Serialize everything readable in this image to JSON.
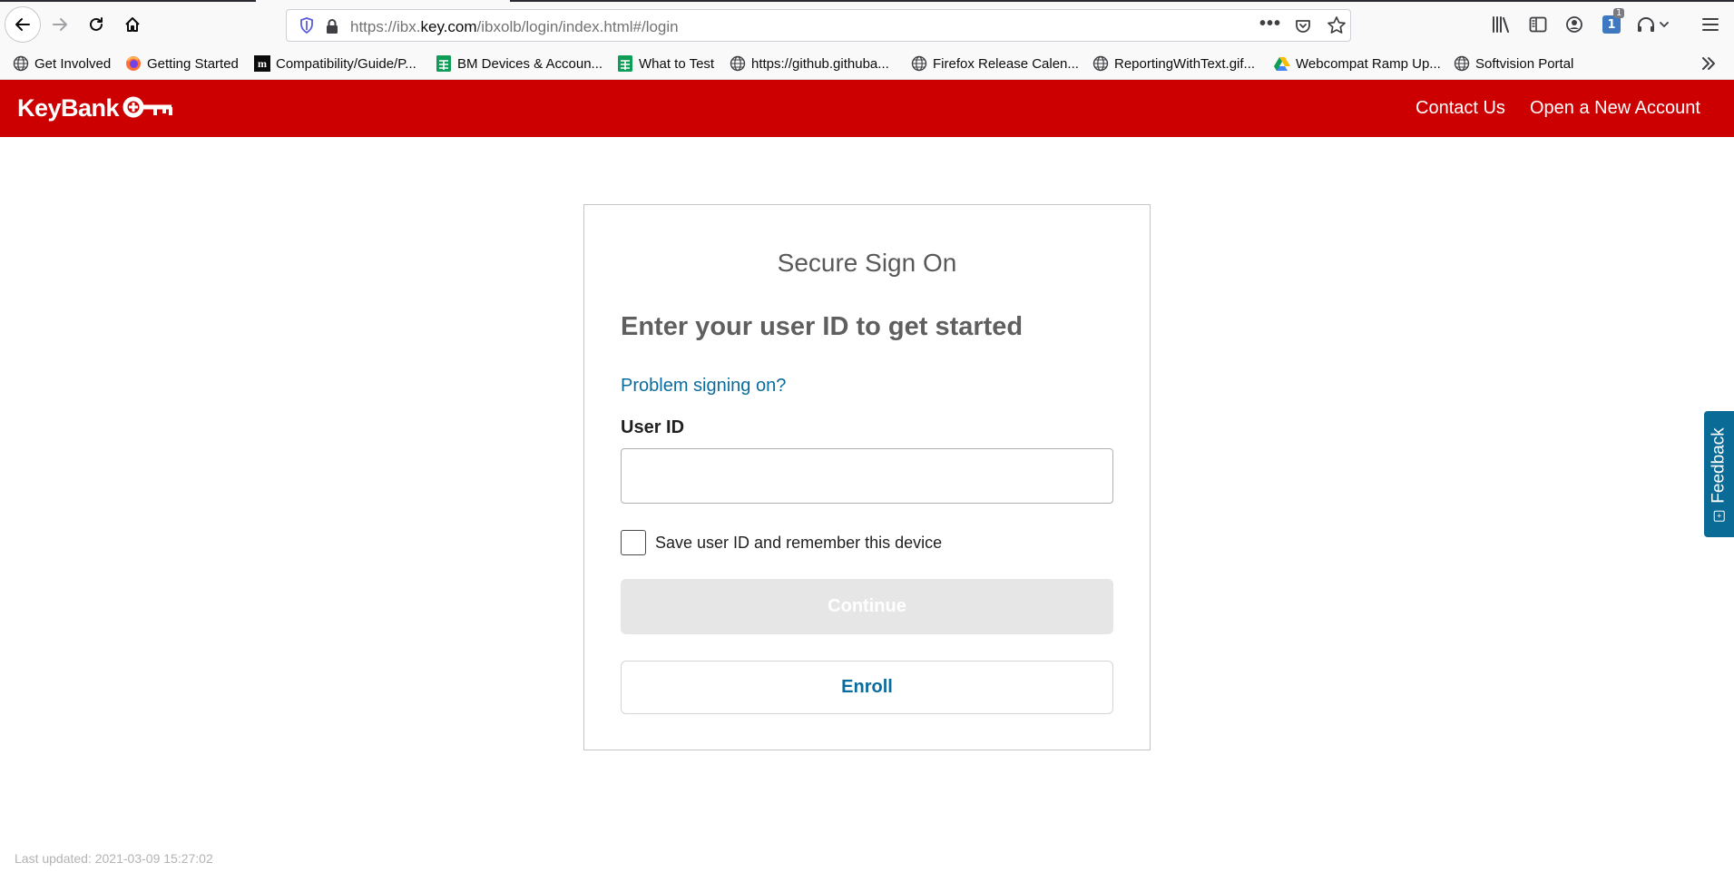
{
  "browser": {
    "url_prefix": "https://ibx.",
    "url_domain": "key.com",
    "url_path": "/ibxolb/login/index.html#/login",
    "page_actions_icon": "•••",
    "extension_badge": "1",
    "extension_label": "1"
  },
  "bookmarks": [
    {
      "label": "Get Involved",
      "icon": "globe-icon"
    },
    {
      "label": "Getting Started",
      "icon": "firefox-icon"
    },
    {
      "label": "Compatibility/Guide/P...",
      "icon": "m-logo-icon"
    },
    {
      "label": "BM Devices & Accoun...",
      "icon": "sheets-icon"
    },
    {
      "label": "What to Test",
      "icon": "sheets-icon"
    },
    {
      "label": "https://github.githuba...",
      "icon": "globe-icon"
    },
    {
      "label": "Firefox Release Calen...",
      "icon": "globe-icon"
    },
    {
      "label": "ReportingWithText.gif...",
      "icon": "globe-icon"
    },
    {
      "label": "Webcompat Ramp Up...",
      "icon": "drive-icon"
    },
    {
      "label": "Softvision Portal",
      "icon": "globe-icon"
    }
  ],
  "header": {
    "logo_text": "KeyBank",
    "contact_label": "Contact Us",
    "open_account_label": "Open a New Account",
    "brand_color": "#cc0000"
  },
  "signon": {
    "title": "Secure Sign On",
    "heading": "Enter your user ID to get started",
    "problem_link": "Problem signing on?",
    "userid_label": "User ID",
    "userid_value": "",
    "remember_label": "Save user ID and remember this device",
    "remember_checked": false,
    "continue_label": "Continue",
    "enroll_label": "Enroll",
    "link_color": "#0a6c9e"
  },
  "feedback": {
    "label": "Feedback",
    "color": "#0b6b97"
  },
  "footer": {
    "last_updated": "Last updated: 2021-03-09 15:27:02"
  }
}
